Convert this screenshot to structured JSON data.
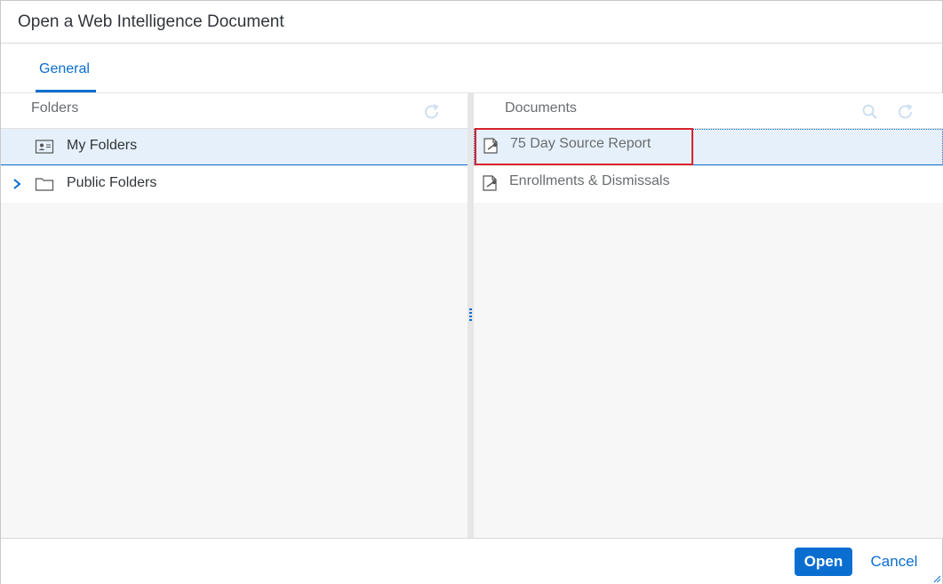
{
  "dialog": {
    "title": "Open a Web Intelligence Document"
  },
  "tabs": [
    {
      "label": "General",
      "active": true
    }
  ],
  "folders_pane": {
    "header": "Folders",
    "items": [
      {
        "label": "My Folders",
        "icon": "user-folder-icon",
        "selected": true,
        "expandable": false
      },
      {
        "label": "Public Folders",
        "icon": "folder-icon",
        "selected": false,
        "expandable": true
      }
    ]
  },
  "documents_pane": {
    "header": "Documents",
    "items": [
      {
        "label": "75 Day Source Report",
        "icon": "webi-document-icon",
        "selected": true
      },
      {
        "label": "Enrollments & Dismissals",
        "icon": "webi-document-icon",
        "selected": false
      }
    ]
  },
  "footer": {
    "open_label": "Open",
    "cancel_label": "Cancel"
  },
  "colors": {
    "accent": "#0a6ed1",
    "selection_bg": "#e5f0fa",
    "highlight": "#d9232d"
  }
}
